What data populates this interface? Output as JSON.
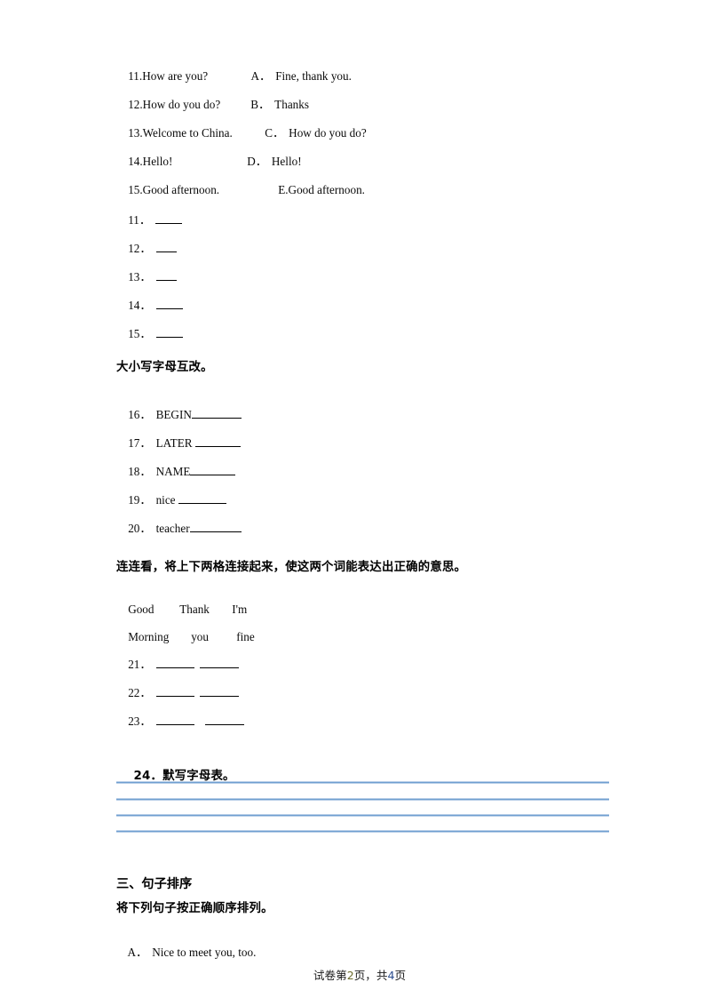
{
  "document": {
    "page_label": "试卷第",
    "page_number": "2",
    "page_mid": "页，共",
    "total_pages": "4",
    "page_suffix": "页"
  },
  "matching_exercise": {
    "prompts": [
      {
        "index": "11.",
        "text": "How are you?"
      },
      {
        "index": "12.",
        "text": "How do you do?"
      },
      {
        "index": "13.",
        "text": "Welcome to China."
      },
      {
        "index": "14.",
        "text": "Hello!"
      },
      {
        "index": "15.",
        "text": "Good afternoon."
      }
    ],
    "options": [
      {
        "letter": "A．",
        "text": "Fine, thank you."
      },
      {
        "letter": "B．",
        "text": "Thanks"
      },
      {
        "letter": "C．",
        "text": "How do you do?"
      },
      {
        "letter": "D．",
        "text": "Hello!"
      },
      {
        "letter": "E.",
        "text": "Good afternoon."
      }
    ],
    "answer_rows": [
      {
        "index": "11．"
      },
      {
        "index": "12．"
      },
      {
        "index": "13．"
      },
      {
        "index": "14．"
      },
      {
        "index": "15．"
      }
    ]
  },
  "case_change": {
    "heading": "大小写字母互改。",
    "items": [
      {
        "index": "16．",
        "word": "BEGIN"
      },
      {
        "index": "17．",
        "word": "LATER "
      },
      {
        "index": "18．",
        "word": "NAME"
      },
      {
        "index": "19．",
        "word": "nice "
      },
      {
        "index": "20．",
        "word": "teacher"
      }
    ]
  },
  "connect_exercise": {
    "heading": "连连看，将上下两格连接起来，使这两个词能表达出正确的意思。",
    "row_top": [
      "Good",
      "Thank",
      "I'm"
    ],
    "row_bottom": [
      "Morning",
      "you",
      "fine"
    ],
    "answer_rows": [
      {
        "index": "21．"
      },
      {
        "index": "22．"
      },
      {
        "index": "23．"
      }
    ]
  },
  "alphabet_task": {
    "index": "24．",
    "heading": "默写字母表。",
    "line_count": 4
  },
  "section_three": {
    "title": "三、句子排序",
    "instruction": "将下列句子按正确顺序排列。",
    "items": [
      {
        "letter": "A．",
        "text": "Nice to meet you, too."
      }
    ]
  }
}
